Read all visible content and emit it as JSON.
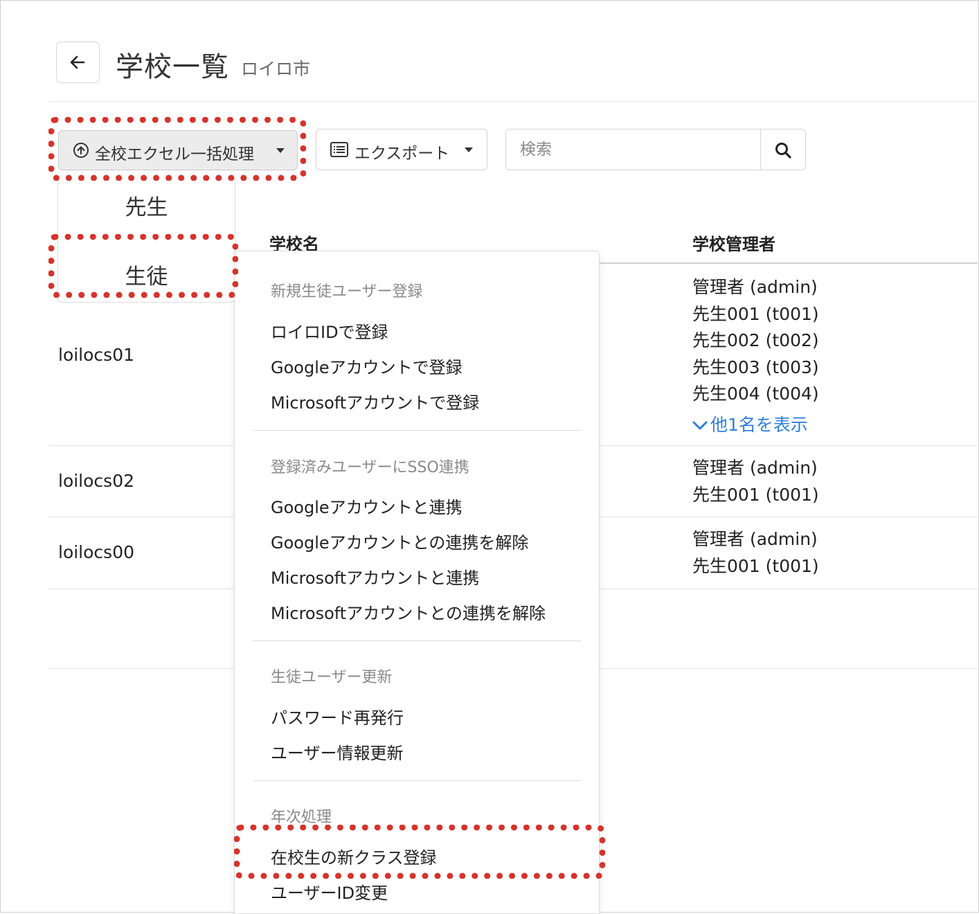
{
  "header": {
    "title": "学校一覧",
    "subtitle": "ロイロ市"
  },
  "toolbar": {
    "bulk_label": "全校エクセル一括処理",
    "export_label": "エクスポート",
    "search_placeholder": "検索"
  },
  "submenu": {
    "items": [
      "先生",
      "生徒"
    ]
  },
  "table": {
    "columns": {
      "school_name": "学校名",
      "admins": "学校管理者"
    },
    "rows": [
      {
        "name": "loilocs01",
        "admins": [
          "管理者 (admin)",
          "先生001 (t001)",
          "先生002 (t002)",
          "先生003 (t003)",
          "先生004 (t004)"
        ],
        "show_more": "他1名を表示"
      },
      {
        "name": "loilocs02",
        "admins": [
          "管理者 (admin)",
          "先生001 (t001)"
        ]
      },
      {
        "name": "loilocs00",
        "admins": [
          "管理者 (admin)",
          "先生001 (t001)"
        ]
      }
    ]
  },
  "dropdown": {
    "sections": [
      {
        "header": "新規生徒ユーザー登録",
        "items": [
          "ロイロIDで登録",
          "Googleアカウントで登録",
          "Microsoftアカウントで登録"
        ]
      },
      {
        "header": "登録済みユーザーにSSO連携",
        "items": [
          "Googleアカウントと連携",
          "Googleアカウントとの連携を解除",
          "Microsoftアカウントと連携",
          "Microsoftアカウントとの連携を解除"
        ]
      },
      {
        "header": "生徒ユーザー更新",
        "items": [
          "パスワード再発行",
          "ユーザー情報更新"
        ]
      },
      {
        "header": "年次処理",
        "items": [
          "在校生の新クラス登録",
          "ユーザーID変更"
        ]
      }
    ]
  },
  "colors": {
    "highlight": "#d6332b",
    "link": "#2f7fd9"
  }
}
